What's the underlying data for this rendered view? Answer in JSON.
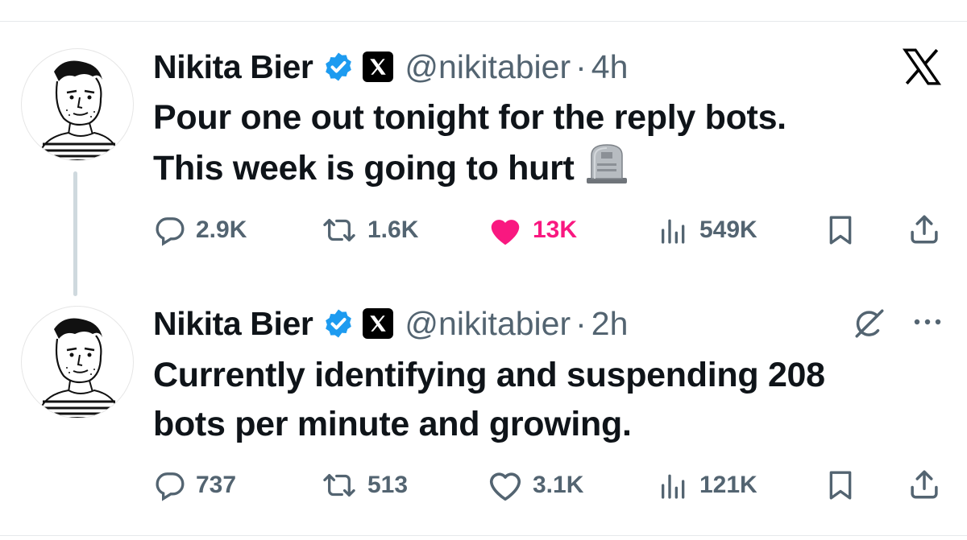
{
  "tweets": [
    {
      "author_name": "Nikita Bier",
      "handle": "@nikitabier",
      "separator": "·",
      "time": "4h",
      "text_lines": [
        "Pour one out tonight for the reply bots.",
        "This week is going to hurt"
      ],
      "emoji_icon": "headstone-icon",
      "metrics": {
        "replies": "2.9K",
        "reposts": "1.6K",
        "likes": "13K",
        "views": "549K"
      },
      "liked": true
    },
    {
      "author_name": "Nikita Bier",
      "handle": "@nikitabier",
      "separator": "·",
      "time": "2h",
      "text_lines": [
        "Currently identifying and suspending 208",
        "bots per minute and growing."
      ],
      "metrics": {
        "replies": "737",
        "reposts": "513",
        "likes": "3.1K",
        "views": "121K"
      },
      "liked": false
    }
  ],
  "icons": [
    "reply-icon",
    "repost-icon",
    "like-icon",
    "views-icon",
    "bookmark-icon",
    "share-icon",
    "x-logo-icon",
    "verified-badge-icon",
    "grok-icon",
    "more-icon"
  ],
  "colors": {
    "text": "#0f1419",
    "secondary": "#536471",
    "like": "#f91880",
    "verified": "#1d9bf0",
    "divider": "#cfd9de"
  }
}
